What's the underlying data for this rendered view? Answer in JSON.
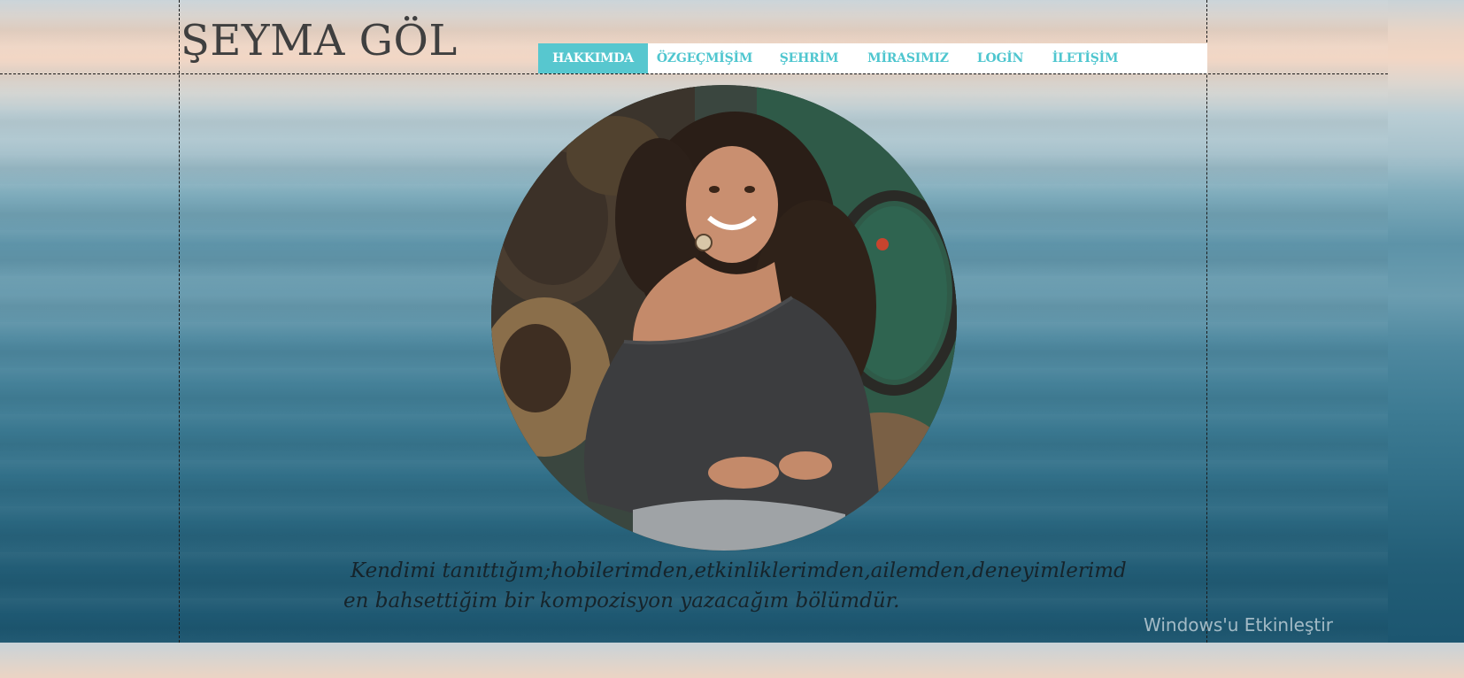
{
  "site": {
    "title": "ŞEYMA GÖL"
  },
  "nav": {
    "items": [
      {
        "label": "HAKKIMDA",
        "active": true
      },
      {
        "label": "ÖZGEÇMİŞİM",
        "active": false
      },
      {
        "label": "ŞEHRİM",
        "active": false
      },
      {
        "label": "MİRASIMIZ",
        "active": false
      },
      {
        "label": "LOGİN",
        "active": false
      },
      {
        "label": "İLETİŞİM",
        "active": false
      }
    ]
  },
  "main": {
    "bio": " Kendimi tanıttığım;hobilerimden,etkinliklerimden,ailemden,deneyimlerimden bahsettiğim bir kompozisyon yazacağım bölümdür."
  },
  "os": {
    "activation_watermark": "Windows'u Etkinleştir"
  },
  "colors": {
    "accent": "#57c7cf",
    "nav_text": "#4fc6cf",
    "title_text": "#3f3f3f"
  }
}
